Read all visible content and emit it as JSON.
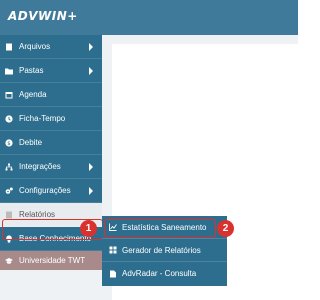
{
  "header": {
    "logo_text": "ADVWIN+"
  },
  "sidebar": {
    "items": [
      {
        "label": "Arquivos",
        "icon": "file-icon"
      },
      {
        "label": "Pastas",
        "icon": "folder-icon"
      },
      {
        "label": "Agenda",
        "icon": "calendar-icon"
      },
      {
        "label": "Ficha-Tempo",
        "icon": "clock-icon"
      },
      {
        "label": "Debite",
        "icon": "money-icon"
      },
      {
        "label": "Integrações",
        "icon": "network-icon"
      },
      {
        "label": "Configurações",
        "icon": "gears-icon"
      },
      {
        "label": "Relatórios",
        "icon": "report-icon"
      },
      {
        "label": "Base Conhecimento",
        "icon": "lightbulb-icon"
      },
      {
        "label": "Universidade TWT",
        "icon": "graduation-cap-icon"
      }
    ]
  },
  "submenu": {
    "items": [
      {
        "label": "Estatística Saneamento",
        "icon": "line-chart-icon"
      },
      {
        "label": "Gerador de Relatórios",
        "icon": "grid-icon"
      },
      {
        "label": "AdvRadar - Consulta",
        "icon": "document-icon"
      }
    ]
  },
  "annotations": {
    "step1": "1",
    "step2": "2"
  },
  "colors": {
    "header": "#3f7a9a",
    "sidebar": "#2d6e8e",
    "highlight": "#d9322e"
  }
}
